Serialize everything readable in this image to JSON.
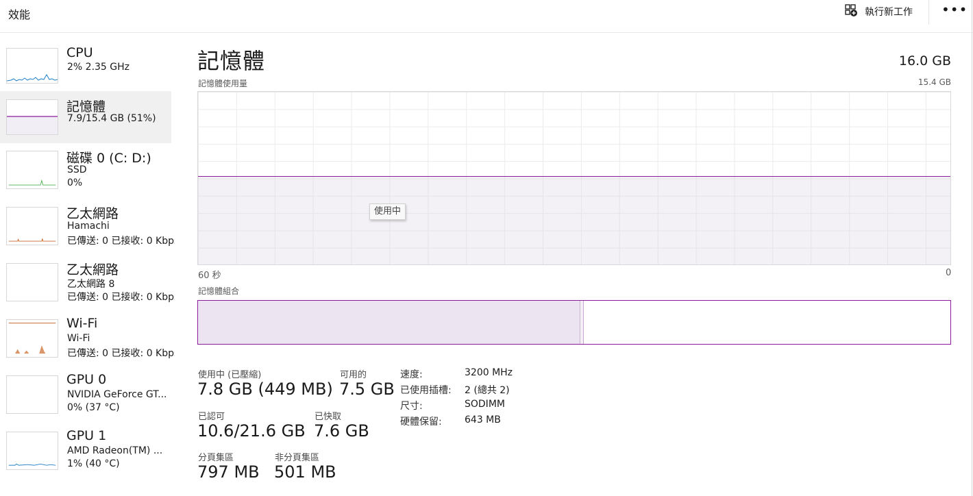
{
  "header": {
    "title": "效能",
    "run_task_label": "執行新工作",
    "more_label": "•••"
  },
  "sidebar": {
    "items": [
      {
        "title": "CPU",
        "line1": "2% 2.35 GHz",
        "line2": ""
      },
      {
        "title": "記憶體",
        "line1": "7.9/15.4 GB (51%)",
        "line2": ""
      },
      {
        "title": "磁碟 0 (C: D:)",
        "line1": "SSD",
        "line2": "0%"
      },
      {
        "title": "乙太網路",
        "line1": "Hamachi",
        "line2": "已傳送: 0 已接收: 0 Kbps"
      },
      {
        "title": "乙太網路",
        "line1": "乙太網路 8",
        "line2": "已傳送: 0 已接收: 0 Kbps"
      },
      {
        "title": "Wi-Fi",
        "line1": "Wi-Fi",
        "line2": "已傳送: 0 已接收: 0 Kbps"
      },
      {
        "title": "GPU 0",
        "line1": "NVIDIA GeForce GT...",
        "line2": "0% (37 °C)"
      },
      {
        "title": "GPU 1",
        "line1": "AMD Radeon(TM) ...",
        "line2": "1% (40 °C)"
      }
    ]
  },
  "main": {
    "title": "記憶體",
    "total": "16.0 GB",
    "usage_label": "記憶體使用量",
    "usage_max": "15.4 GB",
    "usage_fraction": 0.51,
    "tooltip": "使用中",
    "axis_left": "60 秒",
    "axis_right": "0",
    "composition_label": "記憶體組合",
    "composition_in_use_fraction": 0.508
  },
  "stats": {
    "in_use_label": "使用中 (已壓縮)",
    "in_use_value": "7.8 GB (449 MB)",
    "available_label": "可用的",
    "available_value": "7.5 GB",
    "committed_label": "已認可",
    "committed_value": "10.6/21.6 GB",
    "cached_label": "已快取",
    "cached_value": "7.6 GB",
    "paged_label": "分頁集區",
    "paged_value": "797 MB",
    "nonpaged_label": "非分頁集區",
    "nonpaged_value": "501 MB"
  },
  "details": {
    "speed_label": "速度:",
    "speed_value": "3200 MHz",
    "slots_label": "已使用插槽:",
    "slots_value": "2 (總共 2)",
    "form_label": "尺寸:",
    "form_value": "SODIMM",
    "reserved_label": "硬體保留:",
    "reserved_value": "643 MB"
  },
  "colors": {
    "memory_accent": "#8b1a9c",
    "cpu_accent": "#1f7fc4",
    "disk_accent": "#4caf50",
    "network_accent": "#c96a2a"
  }
}
